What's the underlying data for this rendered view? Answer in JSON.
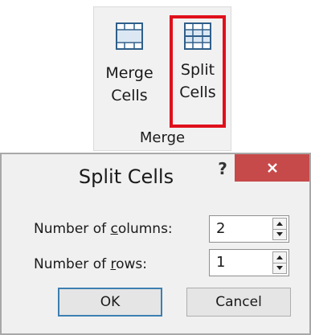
{
  "ribbon": {
    "merge_button": {
      "line1": "Merge",
      "line2": "Cells"
    },
    "split_button": {
      "line1": "Split",
      "line2": "Cells"
    },
    "group_label": "Merge"
  },
  "dialog": {
    "title": "Split Cells",
    "help_label": "?",
    "columns": {
      "label_before": "Number of ",
      "label_accel": "c",
      "label_after": "olumns:",
      "value": "2"
    },
    "rows": {
      "label_before": "Number of ",
      "label_accel": "r",
      "label_after": "ows:",
      "value": "1"
    },
    "ok_label": "OK",
    "cancel_label": "Cancel"
  },
  "colors": {
    "highlight_border": "#e0101c",
    "close_button": "#c74a4a",
    "ok_border": "#3c7fb1"
  },
  "icons": [
    "merge-cells-icon",
    "split-cells-icon",
    "close-icon",
    "spin-up-icon",
    "spin-down-icon"
  ]
}
